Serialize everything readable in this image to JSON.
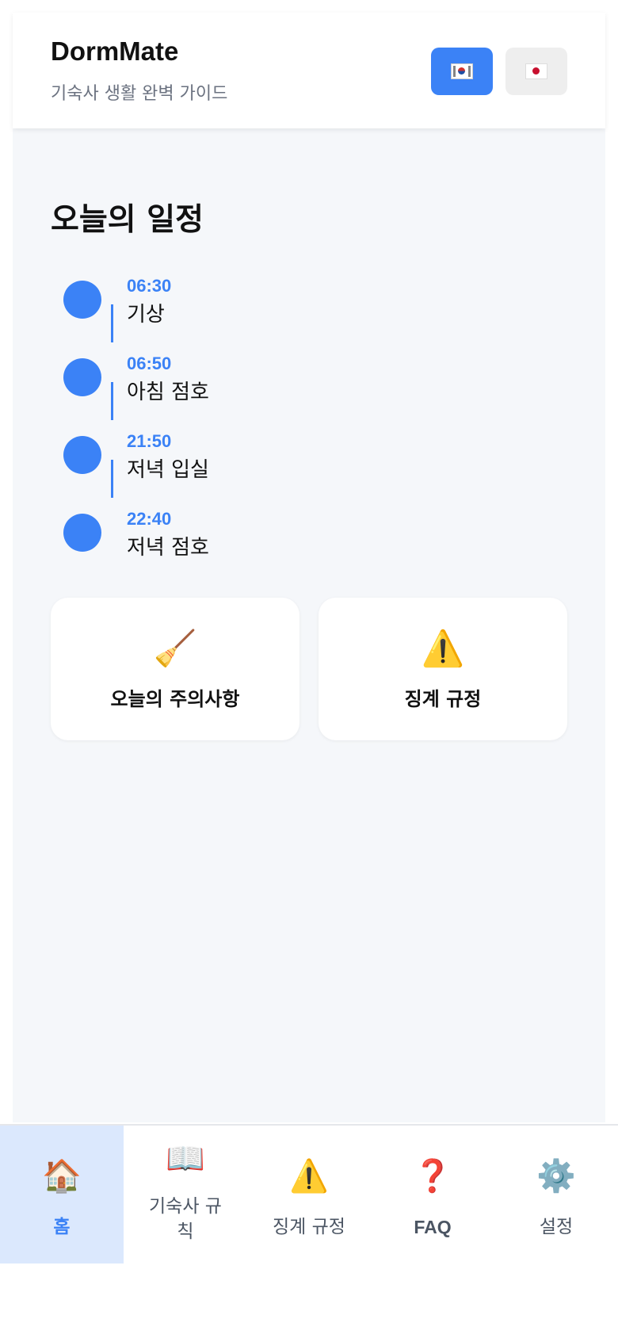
{
  "header": {
    "title": "DormMate",
    "subtitle": "기숙사 생활 완벽 가이드",
    "languages": [
      {
        "code": "ko",
        "flag": "korea-flag-icon",
        "active": true
      },
      {
        "code": "ja",
        "flag": "japan-flag-icon",
        "active": false
      }
    ]
  },
  "schedule": {
    "title": "오늘의 일정",
    "items": [
      {
        "time": "06:30",
        "label": "기상"
      },
      {
        "time": "06:50",
        "label": "아침 점호"
      },
      {
        "time": "21:50",
        "label": "저녁 입실"
      },
      {
        "time": "22:40",
        "label": "저녁 점호"
      }
    ]
  },
  "cards": [
    {
      "icon": "🧹",
      "label": "오늘의 주의사항"
    },
    {
      "icon": "⚠️",
      "label": "징계 규정"
    }
  ],
  "nav": {
    "items": [
      {
        "icon": "🏠",
        "label": "홈",
        "active": true
      },
      {
        "icon": "📖",
        "label": "기숙사 규칙",
        "active": false
      },
      {
        "icon": "⚠️",
        "label": "징계 규정",
        "active": false
      },
      {
        "icon": "❓",
        "label": "FAQ",
        "active": false
      },
      {
        "icon": "⚙️",
        "label": "설정",
        "active": false
      }
    ]
  },
  "colors": {
    "accent": "#3b82f6",
    "background": "#f5f7fa",
    "active_nav_bg": "#dbe8fd"
  }
}
